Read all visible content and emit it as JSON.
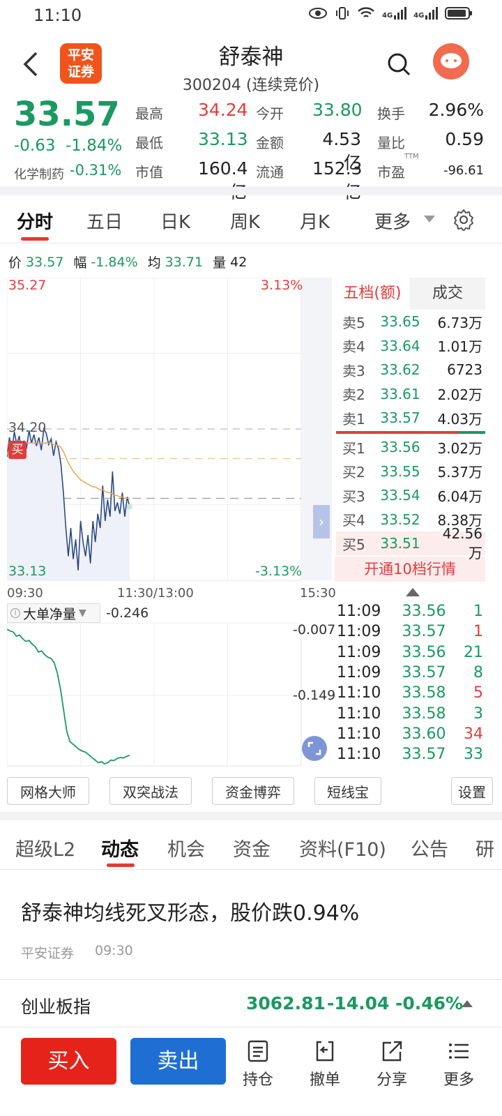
{
  "status_bar": {
    "time": "11:10",
    "net1": "4G",
    "net2": "4G"
  },
  "header": {
    "title": "舒泰神",
    "subtitle": "300204 (连续竞价)",
    "logo_line1": "平安",
    "logo_line2": "证券",
    "brand_color": "#f0541e"
  },
  "quote": {
    "price": "33.57",
    "change": "-0.63",
    "change_pct": "-1.84%",
    "sector": "化学制药",
    "sector_pct": "-0.31%",
    "stats": [
      {
        "label": "最高",
        "value": "34.24",
        "tone": "r"
      },
      {
        "label": "今开",
        "value": "33.80",
        "tone": "g"
      },
      {
        "label": "换手",
        "value": "2.96%",
        "tone": "k"
      },
      {
        "label": "最低",
        "value": "33.13",
        "tone": "g"
      },
      {
        "label": "金额",
        "value": "4.53亿",
        "tone": "k"
      },
      {
        "label": "量比",
        "value": "0.59",
        "tone": "k"
      },
      {
        "label": "市值",
        "value": "160.4亿",
        "tone": "k"
      },
      {
        "label": "流通",
        "value": "152.3亿",
        "tone": "k"
      },
      {
        "label": "市盈",
        "value": "-96.61",
        "tone": "k",
        "sup": "TTM"
      }
    ]
  },
  "chart_tabs": [
    "分时",
    "五日",
    "日K",
    "周K",
    "月K",
    "更多"
  ],
  "info_line": {
    "price_label": "价",
    "price": "33.57",
    "range_label": "幅",
    "range": "-1.84%",
    "avg_label": "均",
    "avg": "33.71",
    "vol_label": "量",
    "vol": "42"
  },
  "chart_data": {
    "type": "line",
    "ylim": [
      33.13,
      35.27
    ],
    "y_top_label": "35.27",
    "y_bottom_label": "33.13",
    "pct_top": "3.13%",
    "pct_bottom": "-3.13%",
    "ref_line_label": "34.20",
    "ref_line": 34.2,
    "avg_line": 33.71,
    "x_labels": [
      "09:30",
      "11:30/13:00",
      "15:30"
    ],
    "buy_marker": "买",
    "series": [
      {
        "values": [
          34.0,
          34.14,
          34.05,
          34.18,
          34.09,
          34.15,
          34.02,
          34.11,
          34.07,
          34.19,
          34.1,
          34.16,
          34.08,
          34.14,
          34.05,
          34.2,
          34.17,
          34.09,
          34.13,
          34.01,
          34.11,
          34.06,
          33.95,
          33.75,
          33.5,
          33.3,
          33.5,
          33.28,
          33.42,
          33.2,
          33.55,
          33.4,
          33.3,
          33.45,
          33.25,
          33.55,
          33.4,
          33.6,
          33.5,
          33.8,
          33.55,
          33.7,
          33.58,
          33.9,
          33.62,
          33.68,
          33.6,
          33.75,
          33.58,
          33.72,
          33.65
        ]
      },
      {
        "values": [
          34.02,
          34.06,
          34.07,
          34.08,
          34.08,
          34.09,
          34.09,
          34.1,
          34.1,
          34.1,
          34.1,
          34.1,
          34.1,
          34.1,
          34.1,
          34.1,
          34.1,
          34.1,
          34.1,
          34.09,
          34.09,
          34.08,
          34.07,
          34.04,
          34.0,
          33.96,
          33.93,
          33.9,
          33.88,
          33.86,
          33.84,
          33.83,
          33.82,
          33.81,
          33.8,
          33.79,
          33.79,
          33.78,
          33.77,
          33.77,
          33.76,
          33.75,
          33.75,
          33.74,
          33.73,
          33.73,
          33.72,
          33.72,
          33.71,
          33.71,
          33.71
        ]
      }
    ],
    "indicator": {
      "name": "大单净量",
      "value": "-0.246",
      "top": "-0.007",
      "mid": "-0.149",
      "values": [
        -0.007,
        -0.01,
        -0.012,
        -0.02,
        -0.018,
        -0.025,
        -0.03,
        -0.028,
        -0.035,
        -0.04,
        -0.05,
        -0.048,
        -0.055,
        -0.06,
        -0.062,
        -0.07,
        -0.09,
        -0.12,
        -0.16,
        -0.2,
        -0.22,
        -0.225,
        -0.23,
        -0.235,
        -0.238,
        -0.24,
        -0.245,
        -0.25,
        -0.255,
        -0.26,
        -0.258,
        -0.262,
        -0.26,
        -0.255,
        -0.256,
        -0.252,
        -0.25,
        -0.251,
        -0.248,
        -0.246
      ]
    }
  },
  "orderbook": {
    "tab1": "五档(额)",
    "tab2": "成交",
    "asks": [
      {
        "l": "卖5",
        "p": "33.65",
        "v": "6.73万"
      },
      {
        "l": "卖4",
        "p": "33.64",
        "v": "1.01万"
      },
      {
        "l": "卖3",
        "p": "33.62",
        "v": "6723"
      },
      {
        "l": "卖2",
        "p": "33.61",
        "v": "2.02万"
      },
      {
        "l": "卖1",
        "p": "33.57",
        "v": "4.03万"
      }
    ],
    "bids": [
      {
        "l": "买1",
        "p": "33.56",
        "v": "3.02万"
      },
      {
        "l": "买2",
        "p": "33.55",
        "v": "5.37万"
      },
      {
        "l": "买3",
        "p": "33.54",
        "v": "6.04万"
      },
      {
        "l": "买4",
        "p": "33.52",
        "v": "8.38万"
      },
      {
        "l": "买5",
        "p": "33.51",
        "v": "42.56万"
      }
    ],
    "upgrade": "开通10档行情"
  },
  "ticks": [
    {
      "t": "11:09",
      "p": "33.56",
      "v": "1",
      "c": "g"
    },
    {
      "t": "11:09",
      "p": "33.57",
      "v": "1",
      "c": "r"
    },
    {
      "t": "11:09",
      "p": "33.56",
      "v": "21",
      "c": "g"
    },
    {
      "t": "11:09",
      "p": "33.57",
      "v": "8",
      "c": "g"
    },
    {
      "t": "11:10",
      "p": "33.58",
      "v": "5",
      "c": "r"
    },
    {
      "t": "11:10",
      "p": "33.58",
      "v": "3",
      "c": "g"
    },
    {
      "t": "11:10",
      "p": "33.60",
      "v": "34",
      "c": "r"
    },
    {
      "t": "11:10",
      "p": "33.57",
      "v": "33",
      "c": "g"
    }
  ],
  "tools": [
    "网格大师",
    "双突战法",
    "资金博弈",
    "短线宝",
    "设置"
  ],
  "bottom_tabs": [
    "超级L2",
    "动态",
    "机会",
    "资金",
    "资料(F10)",
    "公告",
    "研"
  ],
  "news": {
    "title": "舒泰神均线死叉形态，股价跌0.94%",
    "source": "平安证券",
    "time": "09:30"
  },
  "index": {
    "name": "创业板指",
    "value": "3062.81",
    "change": "-14.04",
    "pct": "-0.46%"
  },
  "actions": {
    "buy": "买入",
    "sell": "卖出",
    "hold": "持仓",
    "cancel": "撤单",
    "share": "分享",
    "more": "更多"
  }
}
